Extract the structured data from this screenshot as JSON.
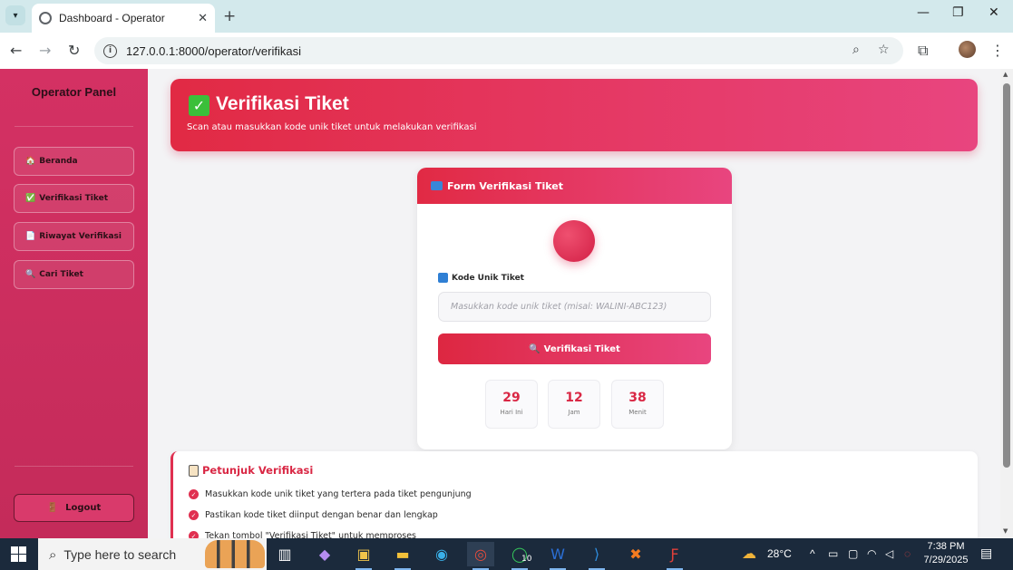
{
  "browser": {
    "tab_title": "Dashboard - Operator",
    "url": "127.0.0.1:8000/operator/verifikasi",
    "tab_close": "✕",
    "new_tab": "+"
  },
  "sidebar": {
    "title": "Operator Panel",
    "items": [
      {
        "icon": "🏠",
        "label": "Beranda"
      },
      {
        "icon": "✅",
        "label": "Verifikasi Tiket"
      },
      {
        "icon": "📄",
        "label": "Riwayat Verifikasi"
      },
      {
        "icon": "🔍",
        "label": "Cari Tiket"
      }
    ],
    "logout": "Logout",
    "logout_icon": "🚪"
  },
  "hero": {
    "title": "Verifikasi Tiket",
    "subtitle": "Scan atau masukkan kode unik tiket untuk melakukan verifikasi"
  },
  "form": {
    "header": "Form Verifikasi Tiket",
    "field_label": "Kode Unik Tiket",
    "placeholder": "Masukkan kode unik tiket (misal: WALINI-ABC123)",
    "value": "",
    "button_icon": "🔍",
    "button": "Verifikasi Tiket",
    "stats": [
      {
        "value": "29",
        "label": "Hari Ini"
      },
      {
        "value": "12",
        "label": "Jam"
      },
      {
        "value": "38",
        "label": "Menit"
      }
    ]
  },
  "guide": {
    "title": "Petunjuk Verifikasi",
    "items": [
      "Masukkan kode unik tiket yang tertera pada tiket pengunjung",
      "Pastikan kode tiket diinput dengan benar dan lengkap",
      "Tekan tombol \"Verifikasi Tiket\" untuk memproses"
    ]
  },
  "taskbar": {
    "search_placeholder": "Type here to search",
    "weather": "28°C",
    "time": "7:38 PM",
    "date": "7/29/2025",
    "whatsapp_badge": "10"
  },
  "colors": {
    "accent": "#e12a44",
    "accent2": "#e8457f",
    "sidebar": "#d43163"
  }
}
